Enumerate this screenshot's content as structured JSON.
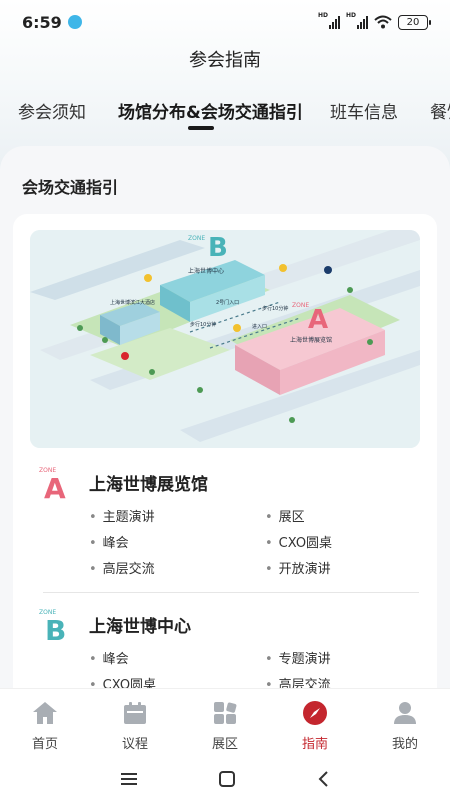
{
  "status": {
    "time": "6:59",
    "battery": "20",
    "sim1": "HD",
    "sim2": "HD"
  },
  "header": {
    "title": "参会指南"
  },
  "tabs": [
    {
      "label": "参会须知",
      "active": false
    },
    {
      "label": "场馆分布&会场交通指引",
      "active": true
    },
    {
      "label": "班车信息",
      "active": false
    },
    {
      "label": "餐饮",
      "active": false
    }
  ],
  "section": {
    "title": "会场交通指引"
  },
  "map": {
    "labels": {
      "zone_b": "ZONE",
      "zone_b_letter": "B",
      "zone_a": "ZONE",
      "zone_a_letter": "A",
      "center": "上海世博中心",
      "hotel": "上海世博滨江大酒店",
      "hall": "上海世博展览馆",
      "gate2": "2号门入口",
      "entrance": "进入口",
      "walk1": "步行10分钟",
      "walk2": "步行10分钟"
    }
  },
  "venues": [
    {
      "zone": "ZONE",
      "letter": "A",
      "color": "#e8667a",
      "name": "上海世博展览馆",
      "items": [
        "主题演讲",
        "展区",
        "峰会",
        "CXO圆桌",
        "高层交流",
        "开放演讲"
      ]
    },
    {
      "zone": "ZONE",
      "letter": "B",
      "color": "#49b3b8",
      "name": "上海世博中心",
      "items": [
        "峰会",
        "专题演讲",
        "CXO圆桌",
        "高层交流"
      ]
    }
  ],
  "tabbar": [
    {
      "label": "首页",
      "icon": "home-icon",
      "active": false
    },
    {
      "label": "议程",
      "icon": "calendar-icon",
      "active": false
    },
    {
      "label": "展区",
      "icon": "grid-icon",
      "active": false
    },
    {
      "label": "指南",
      "icon": "compass-icon",
      "active": true
    },
    {
      "label": "我的",
      "icon": "user-icon",
      "active": false
    }
  ],
  "colors": {
    "accent": "#c4262e",
    "zone_a": "#e8667a",
    "zone_b": "#49b3b8"
  }
}
